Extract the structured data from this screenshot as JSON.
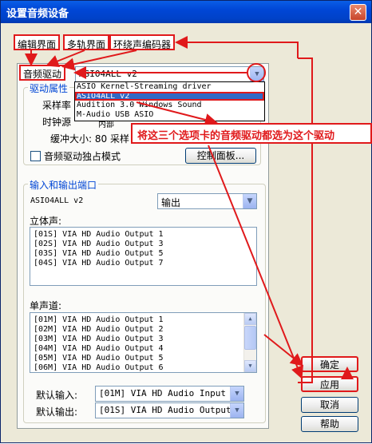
{
  "window": {
    "title": "设置音频设备",
    "close_glyph": "✕"
  },
  "tabs": [
    "编辑界面",
    "多轨界面",
    "环绕声编码器"
  ],
  "active_tab": "音频驱动",
  "driver": {
    "selected": "ASIO4ALL v2",
    "options": [
      "ASIO Kernel-Streaming driver",
      "ASIO4ALL v2",
      "Audition 3.0 Windows Sound",
      "M-Audio USB ASIO"
    ],
    "selected_index": 1
  },
  "driver_props": {
    "group_label": "驱动属性",
    "sample_rate_label": "采样率",
    "clock_source_label": "时钟源",
    "clock_source_value": "内部",
    "buffer_label": "缓冲大小: 80 采样",
    "exclusive_label": "音频驱动独占模式",
    "exclusive_checked": false,
    "control_panel_button": "控制面板..."
  },
  "ports": {
    "group_label": "输入和输出端口",
    "device": "ASIO4ALL v2",
    "direction": "输出",
    "stereo_label": "立体声:",
    "stereo": [
      "[01S] VIA HD Audio Output 1",
      "[02S] VIA HD Audio Output 3",
      "[03S] VIA HD Audio Output 5",
      "[04S] VIA HD Audio Output 7"
    ],
    "mono_label": "单声道:",
    "mono": [
      "[01M] VIA HD Audio Output 1",
      "[02M] VIA HD Audio Output 2",
      "[03M] VIA HD Audio Output 3",
      "[04M] VIA HD Audio Output 4",
      "[05M] VIA HD Audio Output 5",
      "[06M] VIA HD Audio Output 6"
    ],
    "default_input_label": "默认输入:",
    "default_input": "[01M] VIA HD Audio Input 1",
    "default_output_label": "默认输出:",
    "default_output": "[01S] VIA HD Audio Output 1"
  },
  "buttons": {
    "ok": "确定",
    "apply": "应用",
    "cancel": "取消",
    "help": "帮助"
  },
  "annotation": "将这三个选项卡的音频驱动都选为这个驱动",
  "colors": {
    "annotation_red": "#e0191b",
    "selection_blue": "#316ac5",
    "title_blue": "#0046d6"
  }
}
